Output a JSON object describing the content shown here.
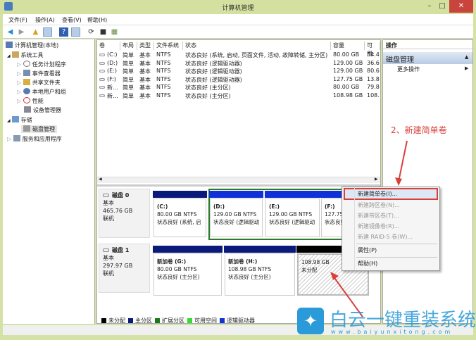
{
  "window": {
    "title": "计算机管理",
    "minimize": "–",
    "maximize": "□",
    "close": "✕"
  },
  "menubar": [
    "文件(F)",
    "操作(A)",
    "查看(V)",
    "帮助(H)"
  ],
  "toolbar": [
    "back-icon",
    "forward-icon",
    "up-icon",
    "show-hide-tree-icon",
    "help-icon",
    "properties-icon",
    "refresh-icon",
    "export-icon",
    "settings-icon"
  ],
  "tree": [
    {
      "label": "计算机管理(本地)",
      "level": 0,
      "icon": "computer-icon"
    },
    {
      "label": "系统工具",
      "level": 1,
      "icon": "tools-icon",
      "expander": "◢"
    },
    {
      "label": "任务计划程序",
      "level": 2,
      "icon": "clock-icon",
      "expander": "▷"
    },
    {
      "label": "事件查看器",
      "level": 2,
      "icon": "event-icon",
      "expander": "▷"
    },
    {
      "label": "共享文件夹",
      "level": 2,
      "icon": "folder-icon",
      "expander": "▷"
    },
    {
      "label": "本地用户和组",
      "level": 2,
      "icon": "users-icon",
      "expander": "▷"
    },
    {
      "label": "性能",
      "level": 2,
      "icon": "performance-icon",
      "expander": "▷"
    },
    {
      "label": "设备管理器",
      "level": 2,
      "icon": "device-icon",
      "expander": ""
    },
    {
      "label": "存储",
      "level": 1,
      "icon": "storage-icon",
      "expander": "◢"
    },
    {
      "label": "磁盘管理",
      "level": 2,
      "icon": "disk-icon",
      "expander": "",
      "selected": true
    },
    {
      "label": "服务和应用程序",
      "level": 1,
      "icon": "services-icon",
      "expander": "▷"
    }
  ],
  "volume_table": {
    "headers": [
      "卷",
      "布局",
      "类型",
      "文件系统",
      "状态",
      "容量",
      "可用:"
    ],
    "rows": [
      [
        "(C:)",
        "简单",
        "基本",
        "NTFS",
        "状态良好 (系统, 启动, 页面文件, 活动, 故障转储, 主分区)",
        "80.00 GB",
        "54.4"
      ],
      [
        "(D:)",
        "简单",
        "基本",
        "NTFS",
        "状态良好 (逻辑驱动器)",
        "129.00 GB",
        "36.6"
      ],
      [
        "(E:)",
        "简单",
        "基本",
        "NTFS",
        "状态良好 (逻辑驱动器)",
        "129.00 GB",
        "80.6"
      ],
      [
        "(F:)",
        "简单",
        "基本",
        "NTFS",
        "状态良好 (逻辑驱动器)",
        "127.75 GB",
        "13.8"
      ],
      [
        "新...",
        "简单",
        "基本",
        "NTFS",
        "状态良好 (主分区)",
        "80.00 GB",
        "79.8"
      ],
      [
        "新...",
        "简单",
        "基本",
        "NTFS",
        "状态良好 (主分区)",
        "108.98 GB",
        "108."
      ]
    ]
  },
  "disks": [
    {
      "name": "磁盘 0",
      "type": "基本",
      "size": "465.76 GB",
      "status": "联机",
      "partitions": [
        {
          "title": "(C:)",
          "size": "80.00 GB NTFS",
          "status": "状态良好 (系统, 启",
          "bar": "#0a1a7a"
        },
        {
          "title": "(D:)",
          "size": "129.00 GB NTFS",
          "status": "状态良好 (逻辑驱动",
          "bar": "#1030d8"
        },
        {
          "title": "(E:)",
          "size": "129.00 GB NTFS",
          "status": "状态良好 (逻辑驱动",
          "bar": "#1030d8"
        },
        {
          "title": "(F:)",
          "size": "127.75",
          "status": "状态良好",
          "bar": "#1030d8"
        }
      ]
    },
    {
      "name": "磁盘 1",
      "type": "基本",
      "size": "297.97 GB",
      "status": "联机",
      "partitions": [
        {
          "title": "新加卷  (G:)",
          "size": "80.00 GB NTFS",
          "status": "状态良好 (主分区)",
          "bar": "#0a1a7a"
        },
        {
          "title": "新加卷  (H:)",
          "size": "108.98 GB NTFS",
          "status": "状态良好 (主分区)",
          "bar": "#0a1a7a"
        },
        {
          "title": "",
          "size": "108.98 GB",
          "status": "未分配",
          "bar": "#000000"
        }
      ]
    }
  ],
  "legend": [
    {
      "label": "未分配",
      "color": "#000000"
    },
    {
      "label": "主分区",
      "color": "#0a1a7a"
    },
    {
      "label": "扩展分区",
      "color": "#1a7a1a"
    },
    {
      "label": "可用空间",
      "color": "#33dd33"
    },
    {
      "label": "逻辑驱动器",
      "color": "#1030d8"
    }
  ],
  "actions": {
    "header": "操作",
    "section": "磁盘管理",
    "item": "更多操作"
  },
  "context_menu": [
    {
      "label": "新建简单卷(I)...",
      "enabled": true,
      "highlighted": true
    },
    {
      "label": "新建跨区卷(N)...",
      "enabled": false
    },
    {
      "label": "新建带区卷(T)...",
      "enabled": false
    },
    {
      "label": "新建镜像卷(R)...",
      "enabled": false
    },
    {
      "label": "新建 RAID-5 卷(W)...",
      "enabled": false
    },
    {
      "label": "属性(P)",
      "enabled": true
    },
    {
      "label": "帮助(H)",
      "enabled": true
    }
  ],
  "annotation": "2、新建简单卷",
  "watermark": {
    "brand": "白云一键重装系统",
    "url": "www.baiyunxitong.com"
  },
  "colors": {
    "annotation": "#d9403a",
    "highlight_border": "#d9403a",
    "titlebar": "#d3e09f"
  }
}
